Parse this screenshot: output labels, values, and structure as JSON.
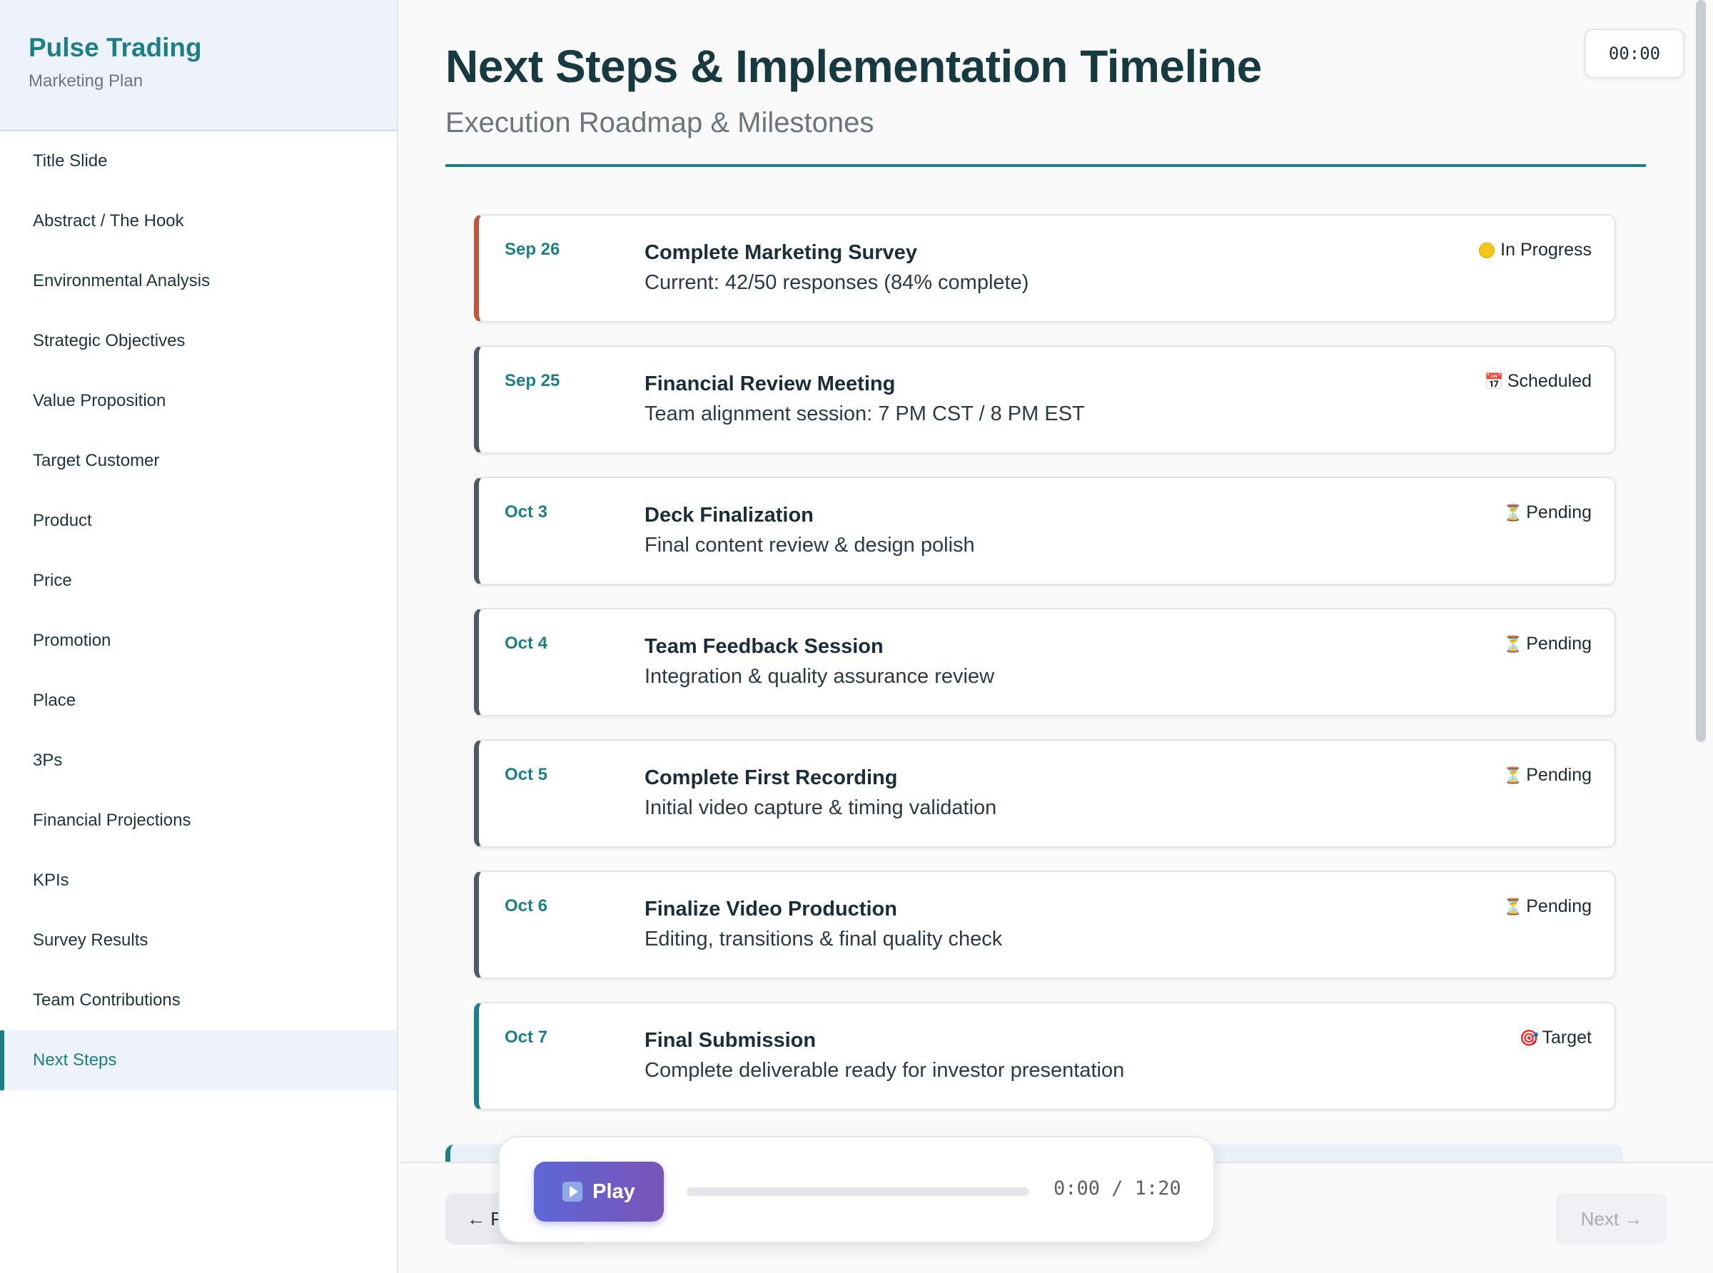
{
  "sidebar": {
    "brand_name": "Pulse Trading",
    "brand_sub": "Marketing Plan",
    "items": [
      {
        "label": "Title Slide"
      },
      {
        "label": "Abstract / The Hook"
      },
      {
        "label": "Environmental Analysis"
      },
      {
        "label": "Strategic Objectives"
      },
      {
        "label": "Value Proposition"
      },
      {
        "label": "Target Customer"
      },
      {
        "label": "Product"
      },
      {
        "label": "Price"
      },
      {
        "label": "Promotion"
      },
      {
        "label": "Place"
      },
      {
        "label": "3Ps"
      },
      {
        "label": "Financial Projections"
      },
      {
        "label": "KPIs"
      },
      {
        "label": "Survey Results"
      },
      {
        "label": "Team Contributions"
      },
      {
        "label": "Next Steps"
      }
    ],
    "active_index": 15
  },
  "header": {
    "title": "Next Steps & Implementation Timeline",
    "subtitle": "Execution Roadmap & Milestones",
    "timer": "00:00"
  },
  "timeline": [
    {
      "date": "Sep 26",
      "title": "Complete Marketing Survey",
      "desc": "Current: 42/50 responses (84% complete)",
      "status": "In Progress",
      "status_icon": "yellow-dot-icon",
      "variant": "in-progress"
    },
    {
      "date": "Sep 25",
      "title": "Financial Review Meeting",
      "desc": "Team alignment session: 7 PM CST / 8 PM EST",
      "status": "Scheduled",
      "status_icon": "calendar-icon",
      "variant": "default"
    },
    {
      "date": "Oct 3",
      "title": "Deck Finalization",
      "desc": "Final content review & design polish",
      "status": "Pending",
      "status_icon": "hourglass-icon",
      "variant": "default"
    },
    {
      "date": "Oct 4",
      "title": "Team Feedback Session",
      "desc": "Integration & quality assurance review",
      "status": "Pending",
      "status_icon": "hourglass-icon",
      "variant": "default"
    },
    {
      "date": "Oct 5",
      "title": "Complete First Recording",
      "desc": "Initial video capture & timing validation",
      "status": "Pending",
      "status_icon": "hourglass-icon",
      "variant": "default"
    },
    {
      "date": "Oct 6",
      "title": "Finalize Video Production",
      "desc": "Editing, transitions & final quality check",
      "status": "Pending",
      "status_icon": "hourglass-icon",
      "variant": "default"
    },
    {
      "date": "Oct 7",
      "title": "Final Submission",
      "desc": "Complete deliverable ready for investor presentation",
      "status": "Target",
      "status_icon": "target-icon",
      "variant": "target"
    }
  ],
  "footer": {
    "prev_label": "← Previous",
    "next_label": "Next →"
  },
  "player": {
    "play_label": "Play",
    "time": "0:00 / 1:20",
    "progress": 0
  },
  "colors": {
    "accent": "#1d7f86",
    "in_progress_bar": "#c0553a",
    "default_bar": "#4e5a63",
    "play_gradient_start": "#5d67d8",
    "play_gradient_end": "#7a54b6"
  }
}
